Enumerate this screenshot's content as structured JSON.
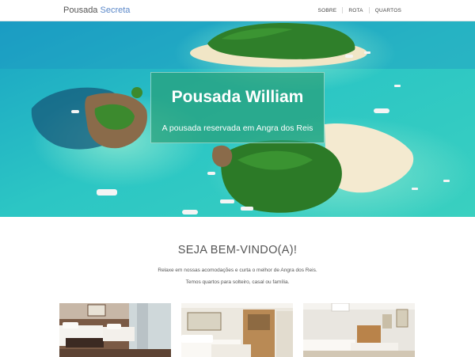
{
  "navbar": {
    "brand_main": "Pousada",
    "brand_accent": "Secreta",
    "links": [
      "SOBRE",
      "ROTA",
      "QUARTOS"
    ]
  },
  "hero": {
    "title": "Pousada William",
    "subtitle": "A pousada reservada em Angra dos Reis"
  },
  "welcome": {
    "title": "SEJA BEM-VINDO(A)!",
    "line1": "Relaxe em nossas acomodações e curta o melhor de Angra dos Reis.",
    "line2": "Temos quartos para solteiro, casal ou família."
  },
  "colors": {
    "brand_accent": "#5b88c9",
    "hero_box": "#28a078",
    "sea": "#27c0c8"
  }
}
